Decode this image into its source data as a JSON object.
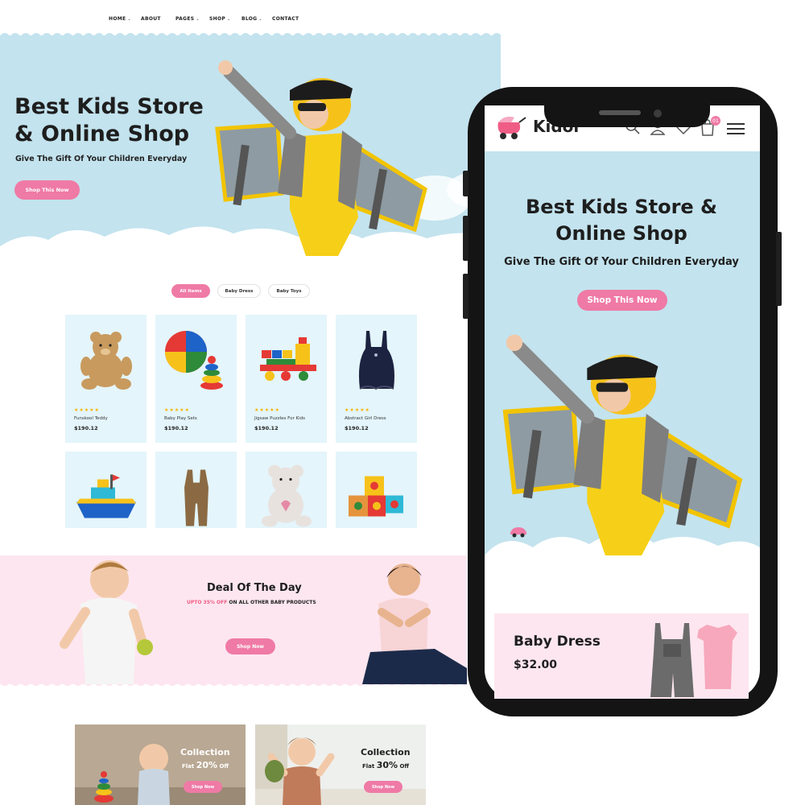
{
  "desktop": {
    "nav": [
      {
        "label": "HOME",
        "dropdown": true
      },
      {
        "label": "ABOUT",
        "dropdown": false
      },
      {
        "label": "PAGES",
        "dropdown": true
      },
      {
        "label": "SHOP",
        "dropdown": true
      },
      {
        "label": "BLOG",
        "dropdown": true
      },
      {
        "label": "CONTACT",
        "dropdown": false
      }
    ],
    "hero": {
      "title": "Best Kids Store & Online Shop",
      "subtitle": "Give The Gift Of Your Children Everyday",
      "button": "Shop This Now"
    },
    "filter_tabs": [
      {
        "label": "All Items",
        "active": true
      },
      {
        "label": "Baby Dress",
        "active": false
      },
      {
        "label": "Baby Toys",
        "active": false
      }
    ],
    "products": [
      {
        "name": "Funskool Teddy",
        "price": "$190.12",
        "rating": "★★★★★",
        "icon": "teddy-bear-icon"
      },
      {
        "name": "Baby Play Sets",
        "price": "$190.12",
        "rating": "★★★★★",
        "icon": "beach-ball-icon"
      },
      {
        "name": "Jigsaw Puzzles For Kids",
        "price": "$190.12",
        "rating": "★★★★★",
        "icon": "toy-train-icon"
      },
      {
        "name": "Abstract Girl Dress",
        "price": "$190.12",
        "rating": "★★★★★",
        "icon": "girl-dress-icon"
      },
      {
        "icon": "toy-boat-icon"
      },
      {
        "icon": "romper-icon"
      },
      {
        "icon": "plush-bear-icon"
      },
      {
        "icon": "toy-blocks-icon"
      }
    ],
    "deal": {
      "title": "Deal Of The Day",
      "highlight": "UPTO 35% OFF",
      "rest": " ON ALL OTHER BABY PRODUCTS",
      "button": "Shop Now"
    },
    "collections": [
      {
        "title": "Collection",
        "flat": "Flat ",
        "percent": "20%",
        "off": " Off",
        "button": "Shop Now"
      },
      {
        "title": "Collection",
        "flat": "Flat ",
        "percent": "30%",
        "off": " Off",
        "button": "Shop Now"
      }
    ]
  },
  "mobile": {
    "logo": "Kidol",
    "cart_count": "01",
    "hero": {
      "title": "Best Kids Store & Online Shop",
      "subtitle": "Give The Gift Of Your Children Everyday",
      "button": "Shop This Now"
    },
    "promo": {
      "title": "Baby Dress",
      "price": "$32.00"
    }
  },
  "colors": {
    "pink": "#ef7aa5",
    "sky": "#c3e3ee",
    "blush": "#fde6ef",
    "card": "#e4f5fb",
    "yellow": "#f6c21a"
  }
}
